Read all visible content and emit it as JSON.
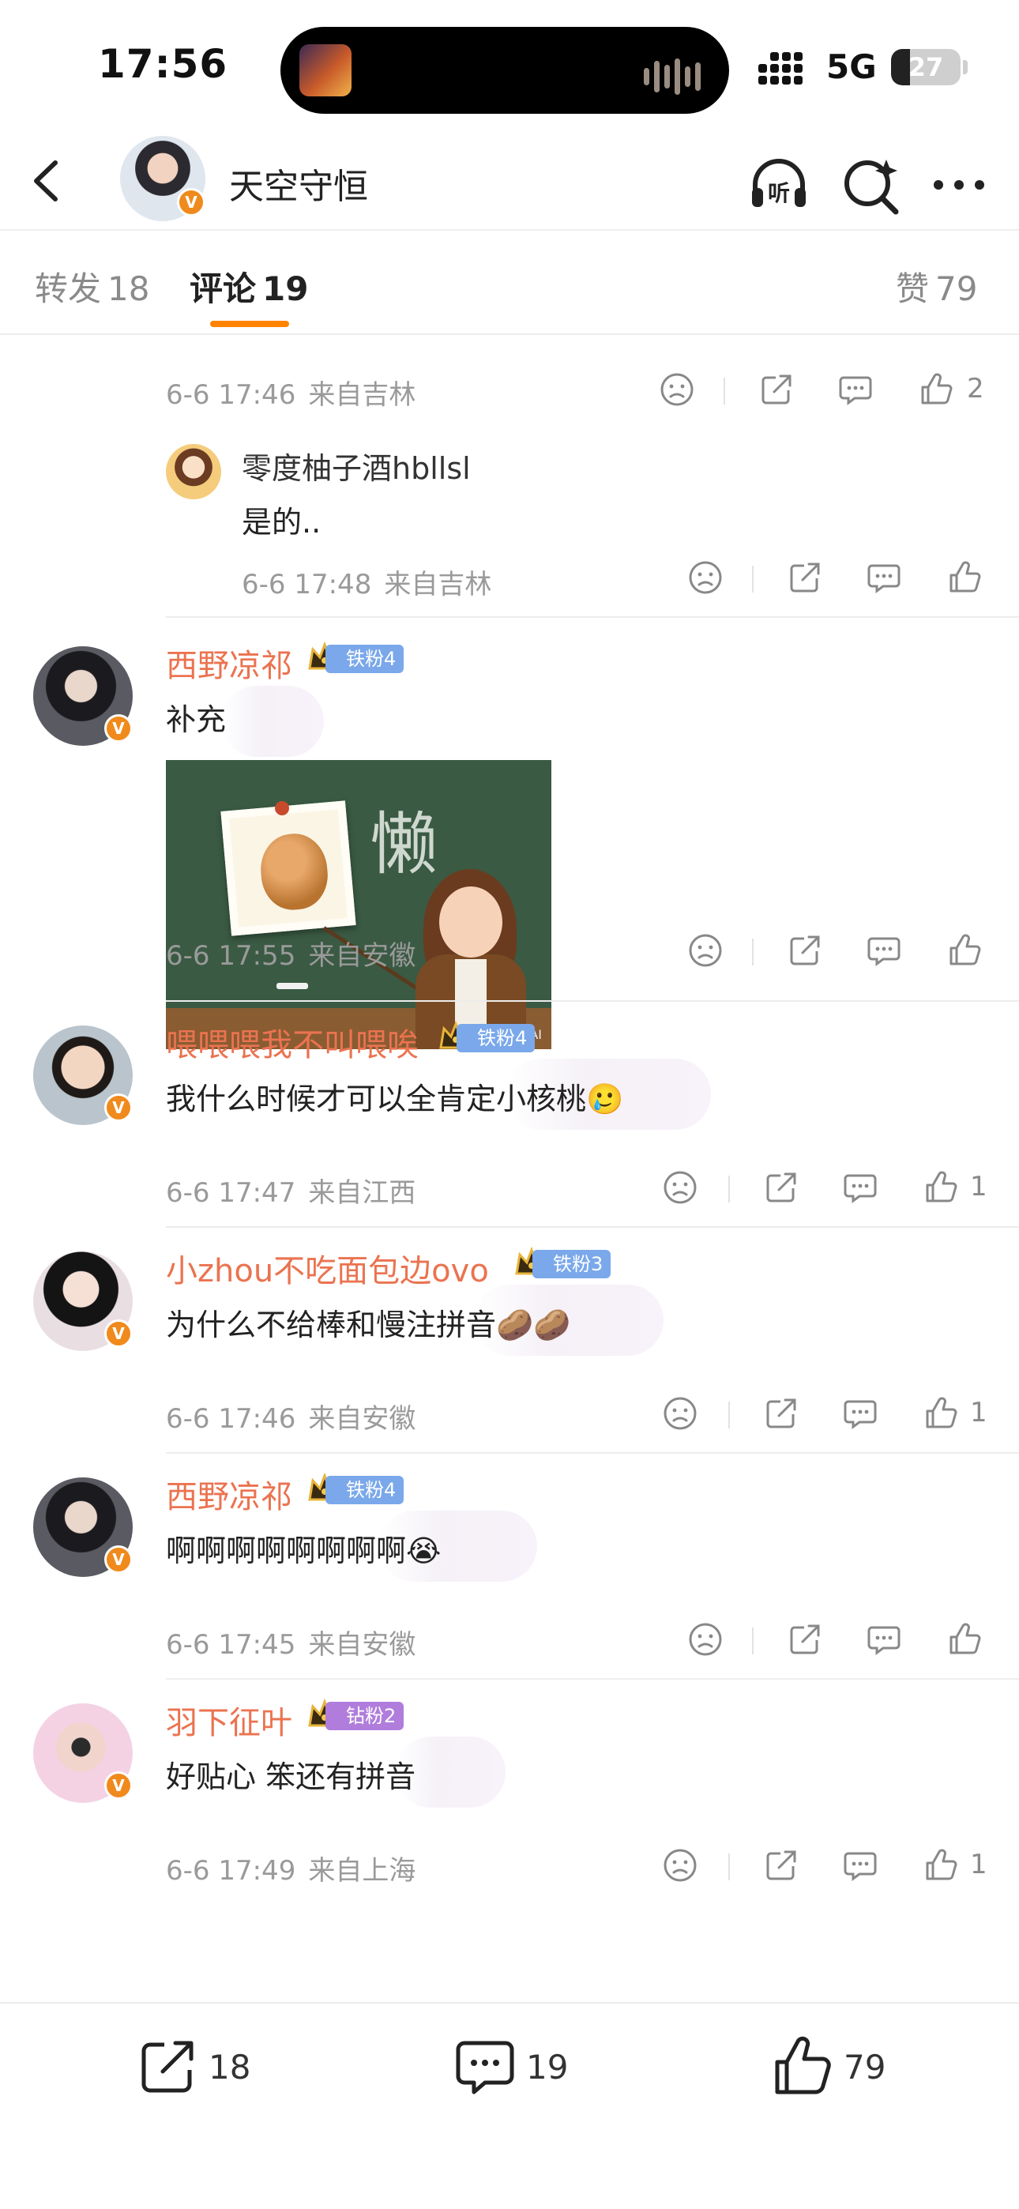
{
  "status_bar": {
    "time": "17:56",
    "network": "5G",
    "battery_level": "27",
    "battery_fraction": 0.27
  },
  "nav": {
    "title": "天空守恒",
    "verified_badge": "V",
    "icons": [
      "back-chevron-icon",
      "listen-headphones-icon",
      "search-sparkle-icon",
      "more-dots-icon"
    ],
    "listen_label": "听"
  },
  "tabs": {
    "repost_label": "转发",
    "repost_count": "18",
    "comment_label": "评论",
    "comment_count": "19",
    "like_label": "赞",
    "like_count": "79"
  },
  "comments": [
    {
      "id": "c0",
      "partial": true,
      "time": "6-6 17:46",
      "location": "来自吉林",
      "likes": "2",
      "reply": {
        "user": "零度柚子酒hbllsl",
        "text": "是的..",
        "time": "6-6 17:48",
        "location": "来自吉林",
        "likes": ""
      }
    },
    {
      "id": "c1",
      "user": "西野凉祁",
      "badge": "铁粉4",
      "badge_color": "#7aa8ea",
      "text": "补充",
      "has_image": true,
      "image_char": "懒",
      "image_watermark": "哥哥AI",
      "time": "6-6 17:55",
      "location": "来自安徽",
      "likes": ""
    },
    {
      "id": "c2",
      "user": "喂喂喂我不叫喂唉",
      "badge": "铁粉4",
      "badge_color": "#7aa8ea",
      "text": "我什么时候才可以全肯定小核桃🥲",
      "time": "6-6 17:47",
      "location": "来自江西",
      "likes": "1"
    },
    {
      "id": "c3",
      "user": "小zhou不吃面包边ovo",
      "badge": "铁粉3",
      "badge_color": "#7aa8ea",
      "text": "为什么不给棒和慢注拼音🥔🥔",
      "time": "6-6 17:46",
      "location": "来自安徽",
      "likes": "1"
    },
    {
      "id": "c4",
      "user": "西野凉祁",
      "badge": "铁粉4",
      "badge_color": "#7aa8ea",
      "text": "啊啊啊啊啊啊啊啊😭",
      "time": "6-6 17:45",
      "location": "来自安徽",
      "likes": ""
    },
    {
      "id": "c5",
      "user": "羽下征叶",
      "badge": "钻粉2",
      "badge_color": "#b07ddc",
      "text": "好贴心 笨还有拼音",
      "time": "6-6 17:49",
      "location": "来自上海",
      "likes": "1"
    }
  ],
  "bottom_bar": {
    "repost_count": "18",
    "comment_count": "19",
    "like_count": "79"
  },
  "colors": {
    "accent_orange": "#ff8200",
    "username_orange": "#eb7350",
    "meta_gray": "#9a9a9a"
  }
}
